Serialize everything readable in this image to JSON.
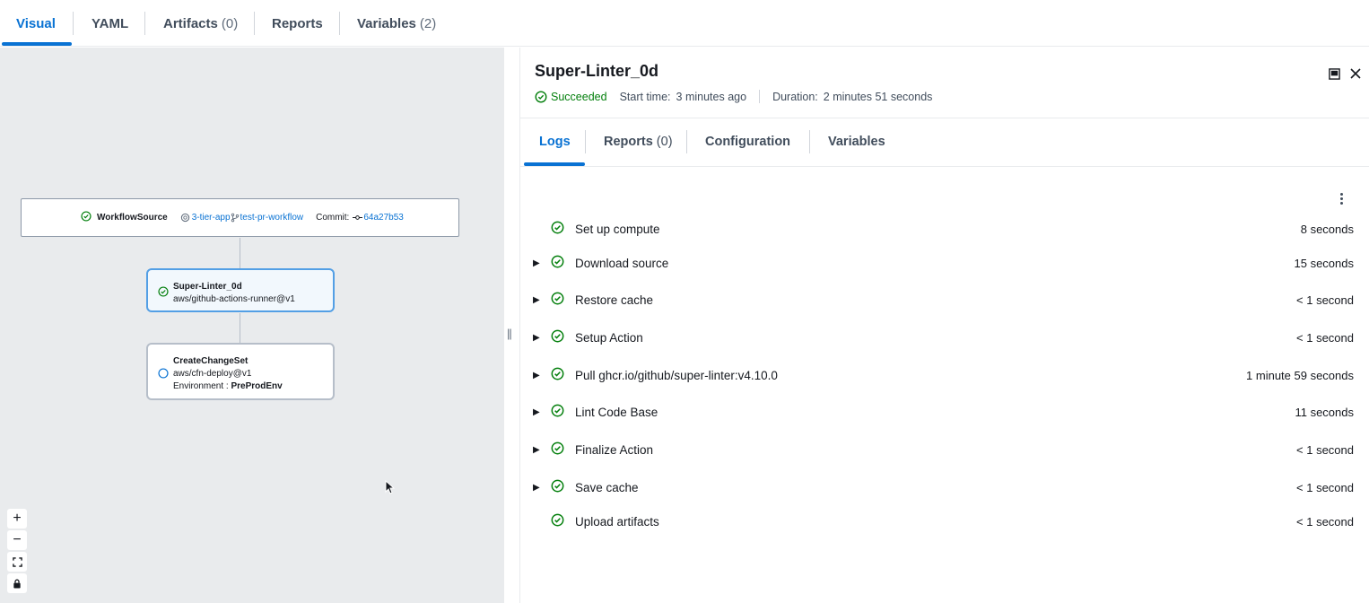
{
  "tabs": [
    {
      "label": "Visual",
      "count": ""
    },
    {
      "label": "YAML",
      "count": ""
    },
    {
      "label": "Artifacts",
      "count": "(0)"
    },
    {
      "label": "Reports",
      "count": ""
    },
    {
      "label": "Variables",
      "count": "(2)"
    }
  ],
  "canvas": {
    "source": {
      "label": "WorkflowSource",
      "repo": "3-tier-app",
      "branch": "test-pr-workflow",
      "commit_label": "Commit:",
      "commit": "64a27b53"
    },
    "actions": [
      {
        "name": "Super-Linter_0d",
        "identifier": "aws/github-actions-runner@v1",
        "env_label": "",
        "env": "",
        "status": "succeeded"
      },
      {
        "name": "CreateChangeSet",
        "identifier": "aws/cfn-deploy@v1",
        "env_label": "Environment :",
        "env": "PreProdEnv",
        "status": "pending"
      }
    ],
    "controls": [
      "+",
      "−",
      "fit",
      "lock"
    ]
  },
  "panel": {
    "title": "Super-Linter_0d",
    "status": "Succeeded",
    "start_label": "Start time:",
    "start_value": "3 minutes ago",
    "duration_label": "Duration:",
    "duration_value": "2 minutes 51 seconds",
    "tabs": [
      {
        "label": "Logs",
        "count": ""
      },
      {
        "label": "Reports",
        "count": "(0)"
      },
      {
        "label": "Configuration",
        "count": ""
      },
      {
        "label": "Variables",
        "count": ""
      }
    ],
    "steps": [
      {
        "name": "Set up compute",
        "duration": "8 seconds",
        "expandable": false
      },
      {
        "name": "Download source",
        "duration": "15 seconds",
        "expandable": true
      },
      {
        "name": "Restore cache",
        "duration": "< 1 second",
        "expandable": true
      },
      {
        "name": "Setup Action",
        "duration": "< 1 second",
        "expandable": true
      },
      {
        "name": "Pull ghcr.io/github/super-linter:v4.10.0",
        "duration": "1 minute 59 seconds",
        "expandable": true
      },
      {
        "name": "Lint Code Base",
        "duration": "11 seconds",
        "expandable": true
      },
      {
        "name": "Finalize Action",
        "duration": "< 1 second",
        "expandable": true
      },
      {
        "name": "Save cache",
        "duration": "< 1 second",
        "expandable": true
      },
      {
        "name": "Upload artifacts",
        "duration": "< 1 second",
        "expandable": false
      }
    ]
  },
  "colors": {
    "accent": "#0972d3",
    "success": "#037f0c",
    "canvas_bg": "#e9ebed"
  },
  "icons": {
    "success": "check-circle-icon",
    "pending": "empty-circle-icon",
    "repo": "repo-icon",
    "branch": "branch-icon",
    "commit": "commit-icon",
    "close": "close-icon",
    "split": "split-view-icon",
    "more": "more-vertical-icon"
  }
}
